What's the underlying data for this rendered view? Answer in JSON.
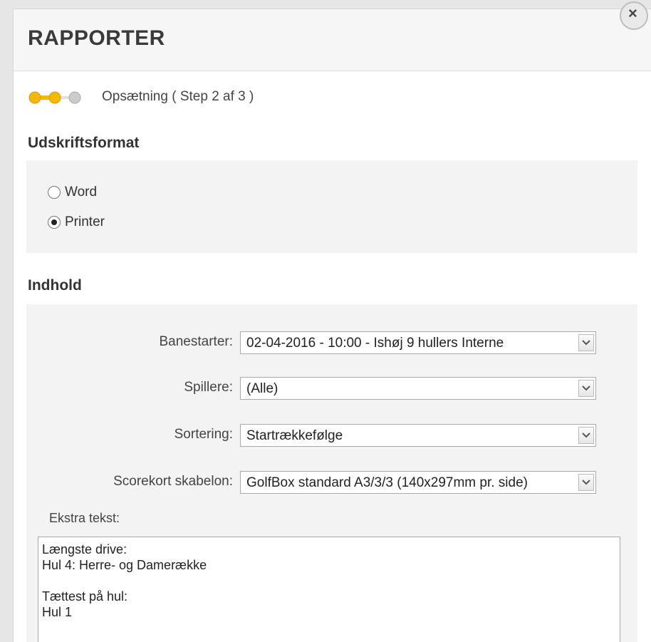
{
  "dialog": {
    "title": "RAPPORTER",
    "close_label": "×"
  },
  "wizard": {
    "step_text": "Opsætning ( Step 2 af 3 )",
    "current_step": 2,
    "total_steps": 3,
    "active_color": "#f5b800",
    "inactive_color": "#cccccc"
  },
  "format": {
    "title": "Udskriftsformat",
    "options": [
      {
        "label": "Word",
        "checked": false
      },
      {
        "label": "Printer",
        "checked": true
      }
    ]
  },
  "content": {
    "title": "Indhold",
    "fields": [
      {
        "label": "Banestarter:",
        "value": "02-04-2016 - 10:00 - Ishøj 9 hullers Interne"
      },
      {
        "label": "Spillere:",
        "value": "(Alle)"
      },
      {
        "label": "Sortering:",
        "value": "Startrækkefølge"
      },
      {
        "label": "Scorekort skabelon:",
        "value": "GolfBox standard A3/3/3 (140x297mm pr. side)"
      }
    ],
    "extra_label": "Ekstra tekst:",
    "extra_lines": [
      "Længste drive:",
      "Hul 4: Herre- og Damerække",
      "",
      "Tættest på hul:",
      "Hul 1"
    ]
  }
}
